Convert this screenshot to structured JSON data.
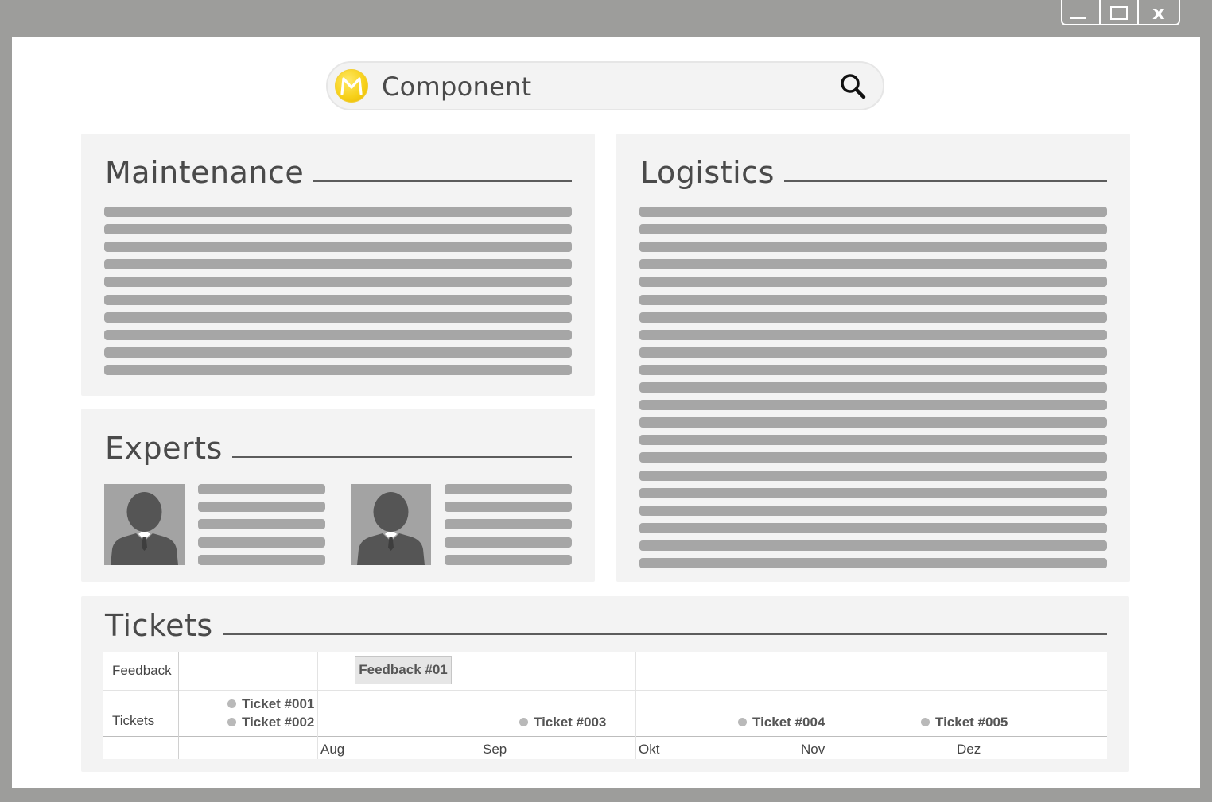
{
  "window": {
    "controls": {
      "close_glyph": "x"
    }
  },
  "search": {
    "value": "Component"
  },
  "panels": {
    "maintenance": {
      "title": "Maintenance"
    },
    "logistics": {
      "title": "Logistics"
    },
    "experts": {
      "title": "Experts"
    },
    "tickets": {
      "title": "Tickets",
      "rows": [
        "Feedback",
        "Tickets"
      ],
      "months": [
        "Aug",
        "Sep",
        "Okt",
        "Nov",
        "Dez"
      ],
      "feedback_items": [
        "Feedback #01"
      ],
      "ticket_items": [
        "Ticket #001",
        "Ticket #002",
        "Ticket #003",
        "Ticket #004",
        "Ticket #005"
      ]
    }
  },
  "colors": {
    "frame": "#9d9d9b",
    "panel": "#f3f3f3",
    "placeholder_line": "#a6a6a6",
    "logo": "#f7d11a"
  }
}
